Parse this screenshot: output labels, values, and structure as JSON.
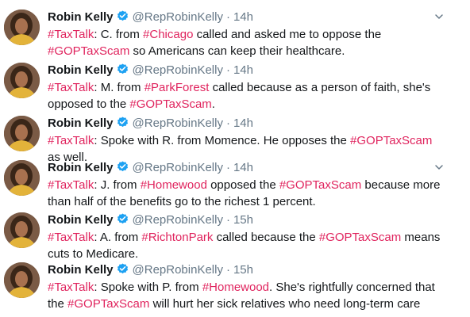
{
  "colors": {
    "hashtag": "#e0245e",
    "verified": "#1da1f2",
    "muted": "#657786",
    "text": "#14171a"
  },
  "icons": {
    "verified": "verified-badge-icon",
    "menu": "chevron-down-icon",
    "avatar": "profile-photo"
  },
  "tweets": [
    {
      "name": "Robin Kelly",
      "handle": "@RepRobinKelly",
      "separator": "·",
      "time": "14h",
      "parts": [
        {
          "text": "#TaxTalk",
          "link": true
        },
        {
          "text": ": C. from ",
          "link": false
        },
        {
          "text": "#Chicago",
          "link": true
        },
        {
          "text": " called and asked me to oppose the ",
          "link": false
        },
        {
          "text": "#GOPTaxScam",
          "link": true
        },
        {
          "text": " so Americans can keep their healthcare.",
          "link": false
        }
      ]
    },
    {
      "name": "Robin Kelly",
      "handle": "@RepRobinKelly",
      "separator": "·",
      "time": "14h",
      "parts": [
        {
          "text": "#TaxTalk",
          "link": true
        },
        {
          "text": ": M. from ",
          "link": false
        },
        {
          "text": "#ParkForest",
          "link": true
        },
        {
          "text": " called because as a person of faith, she's opposed to the ",
          "link": false
        },
        {
          "text": "#GOPTaxScam",
          "link": true
        },
        {
          "text": ".",
          "link": false
        }
      ]
    },
    {
      "name": "Robin Kelly",
      "handle": "@RepRobinKelly",
      "separator": "·",
      "time": "14h",
      "parts": [
        {
          "text": "#TaxTalk",
          "link": true
        },
        {
          "text": ": Spoke with R. from Momence. He opposes the ",
          "link": false
        },
        {
          "text": "#GOPTaxScam",
          "link": true
        },
        {
          "text": " as well.",
          "link": false
        }
      ]
    },
    {
      "name": "Robin Kelly",
      "handle": "@RepRobinKelly",
      "separator": "·",
      "time": "14h",
      "parts": [
        {
          "text": "#TaxTalk",
          "link": true
        },
        {
          "text": ": J. from ",
          "link": false
        },
        {
          "text": "#Homewood",
          "link": true
        },
        {
          "text": " opposed the ",
          "link": false
        },
        {
          "text": "#GOPTaxScam",
          "link": true
        },
        {
          "text": " because more than half of the benefits go to the richest 1 percent.",
          "link": false
        }
      ]
    },
    {
      "name": "Robin Kelly",
      "handle": "@RepRobinKelly",
      "separator": "·",
      "time": "15h",
      "parts": [
        {
          "text": "#TaxTalk",
          "link": true
        },
        {
          "text": ": A. from ",
          "link": false
        },
        {
          "text": "#RichtonPark",
          "link": true
        },
        {
          "text": " called because the ",
          "link": false
        },
        {
          "text": "#GOPTaxScam",
          "link": true
        },
        {
          "text": " means cuts to Medicare.",
          "link": false
        }
      ]
    },
    {
      "name": "Robin Kelly",
      "handle": "@RepRobinKelly",
      "separator": "·",
      "time": "15h",
      "parts": [
        {
          "text": "#TaxTalk",
          "link": true
        },
        {
          "text": ": Spoke with P. from ",
          "link": false
        },
        {
          "text": "#Homewood",
          "link": true
        },
        {
          "text": ". She's rightfully concerned that the ",
          "link": false
        },
        {
          "text": "#GOPTaxScam",
          "link": true
        },
        {
          "text": " will hurt her sick relatives who need long-term care",
          "link": false
        }
      ]
    }
  ]
}
